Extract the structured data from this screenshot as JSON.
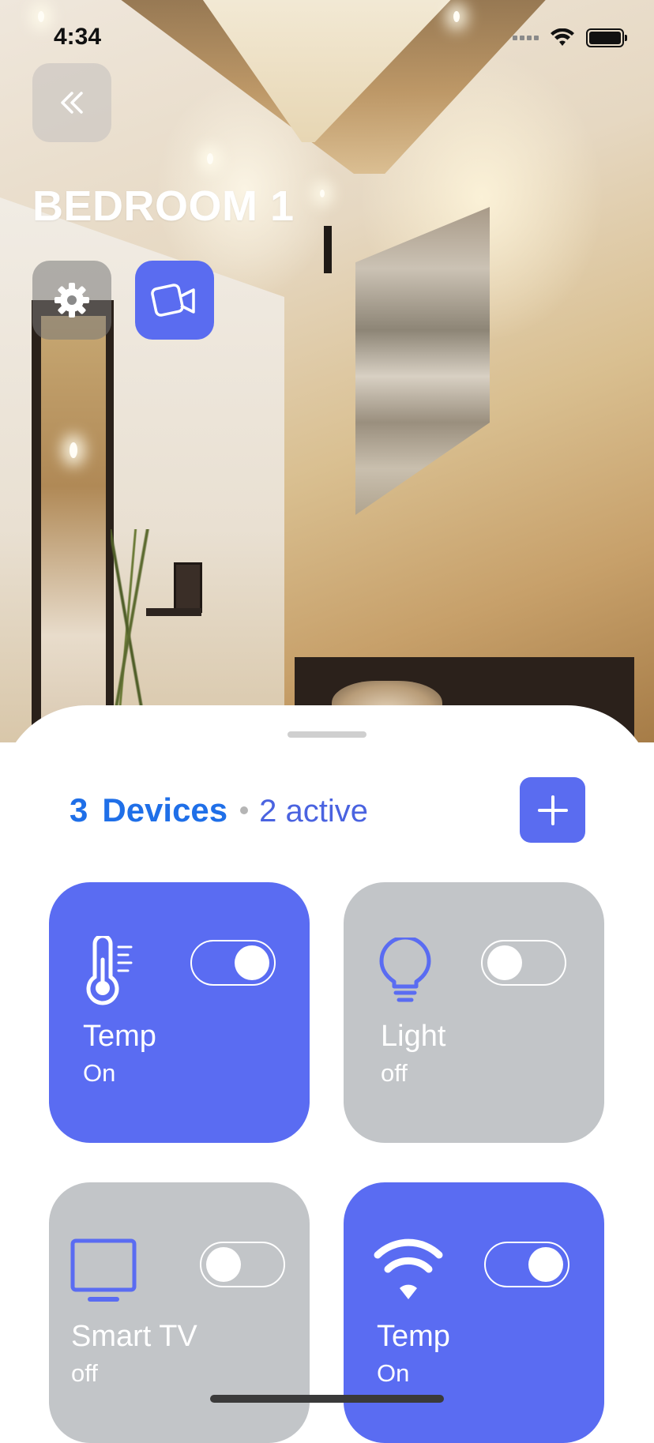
{
  "status_bar": {
    "time": "4:34"
  },
  "header": {
    "room_title": "BEDROOM 1"
  },
  "devices": {
    "count": "3",
    "label": "Devices",
    "active": "2 active"
  },
  "cards": [
    {
      "name": "Temp",
      "state": "On",
      "icon": "thermometer-icon",
      "toggle_on": true
    },
    {
      "name": "Light",
      "state": "off",
      "icon": "lightbulb-icon",
      "toggle_on": false
    },
    {
      "name": "Smart TV",
      "state": "off",
      "icon": "tv-icon",
      "toggle_on": false
    },
    {
      "name": "Temp",
      "state": "On",
      "icon": "wifi-icon",
      "toggle_on": true
    }
  ],
  "colors": {
    "accent": "#5a6cf2",
    "heading_blue": "#1f6fe8",
    "card_off": "#c2c5c8"
  }
}
